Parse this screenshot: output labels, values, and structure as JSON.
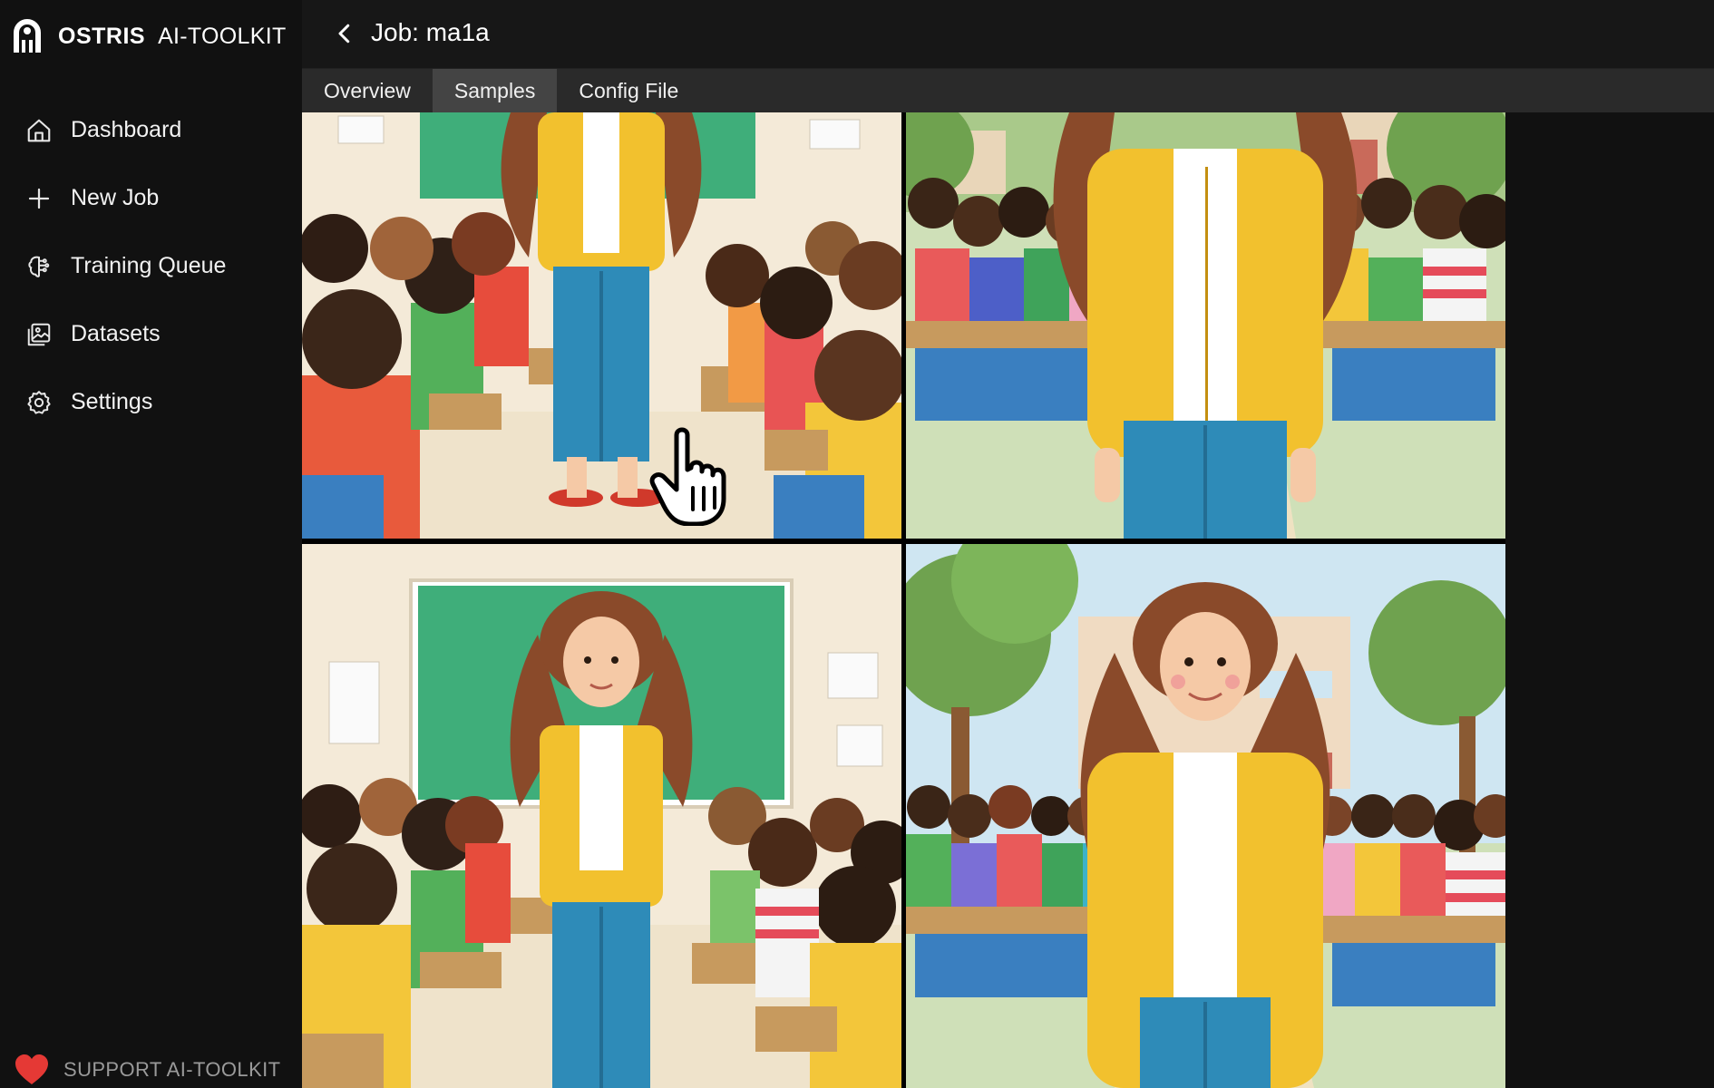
{
  "app": {
    "brand_name": "OSTRIS",
    "brand_sub": "AI-TOOLKIT",
    "logo_icon": "ostris-logo-icon"
  },
  "sidebar": {
    "items": [
      {
        "label": "Dashboard",
        "icon": "home-icon"
      },
      {
        "label": "New Job",
        "icon": "plus-icon"
      },
      {
        "label": "Training Queue",
        "icon": "brain-icon"
      },
      {
        "label": "Datasets",
        "icon": "images-icon"
      },
      {
        "label": "Settings",
        "icon": "gear-icon"
      }
    ],
    "support_label": "SUPPORT AI-TOOLKIT",
    "support_icon": "heart-icon"
  },
  "header": {
    "title": "Job: ma1a",
    "back_icon": "chevron-left-icon"
  },
  "tabs": [
    {
      "label": "Overview",
      "active": false
    },
    {
      "label": "Samples",
      "active": true
    },
    {
      "label": "Config File",
      "active": false
    }
  ],
  "samples": [
    {
      "scene": "classroom",
      "crop": "torso"
    },
    {
      "scene": "outdoor",
      "crop": "torso"
    },
    {
      "scene": "classroom",
      "crop": "portrait"
    },
    {
      "scene": "outdoor",
      "crop": "portrait"
    }
  ],
  "colors": {
    "background": "#111111",
    "tab_bar": "#2a2a2a",
    "tab_active": "#444444",
    "heart": "#e53935",
    "cardigan": "#f2c12e",
    "jeans": "#2e8bb8",
    "hair": "#8a4a2a",
    "chalkboard": "#3fae7a"
  }
}
